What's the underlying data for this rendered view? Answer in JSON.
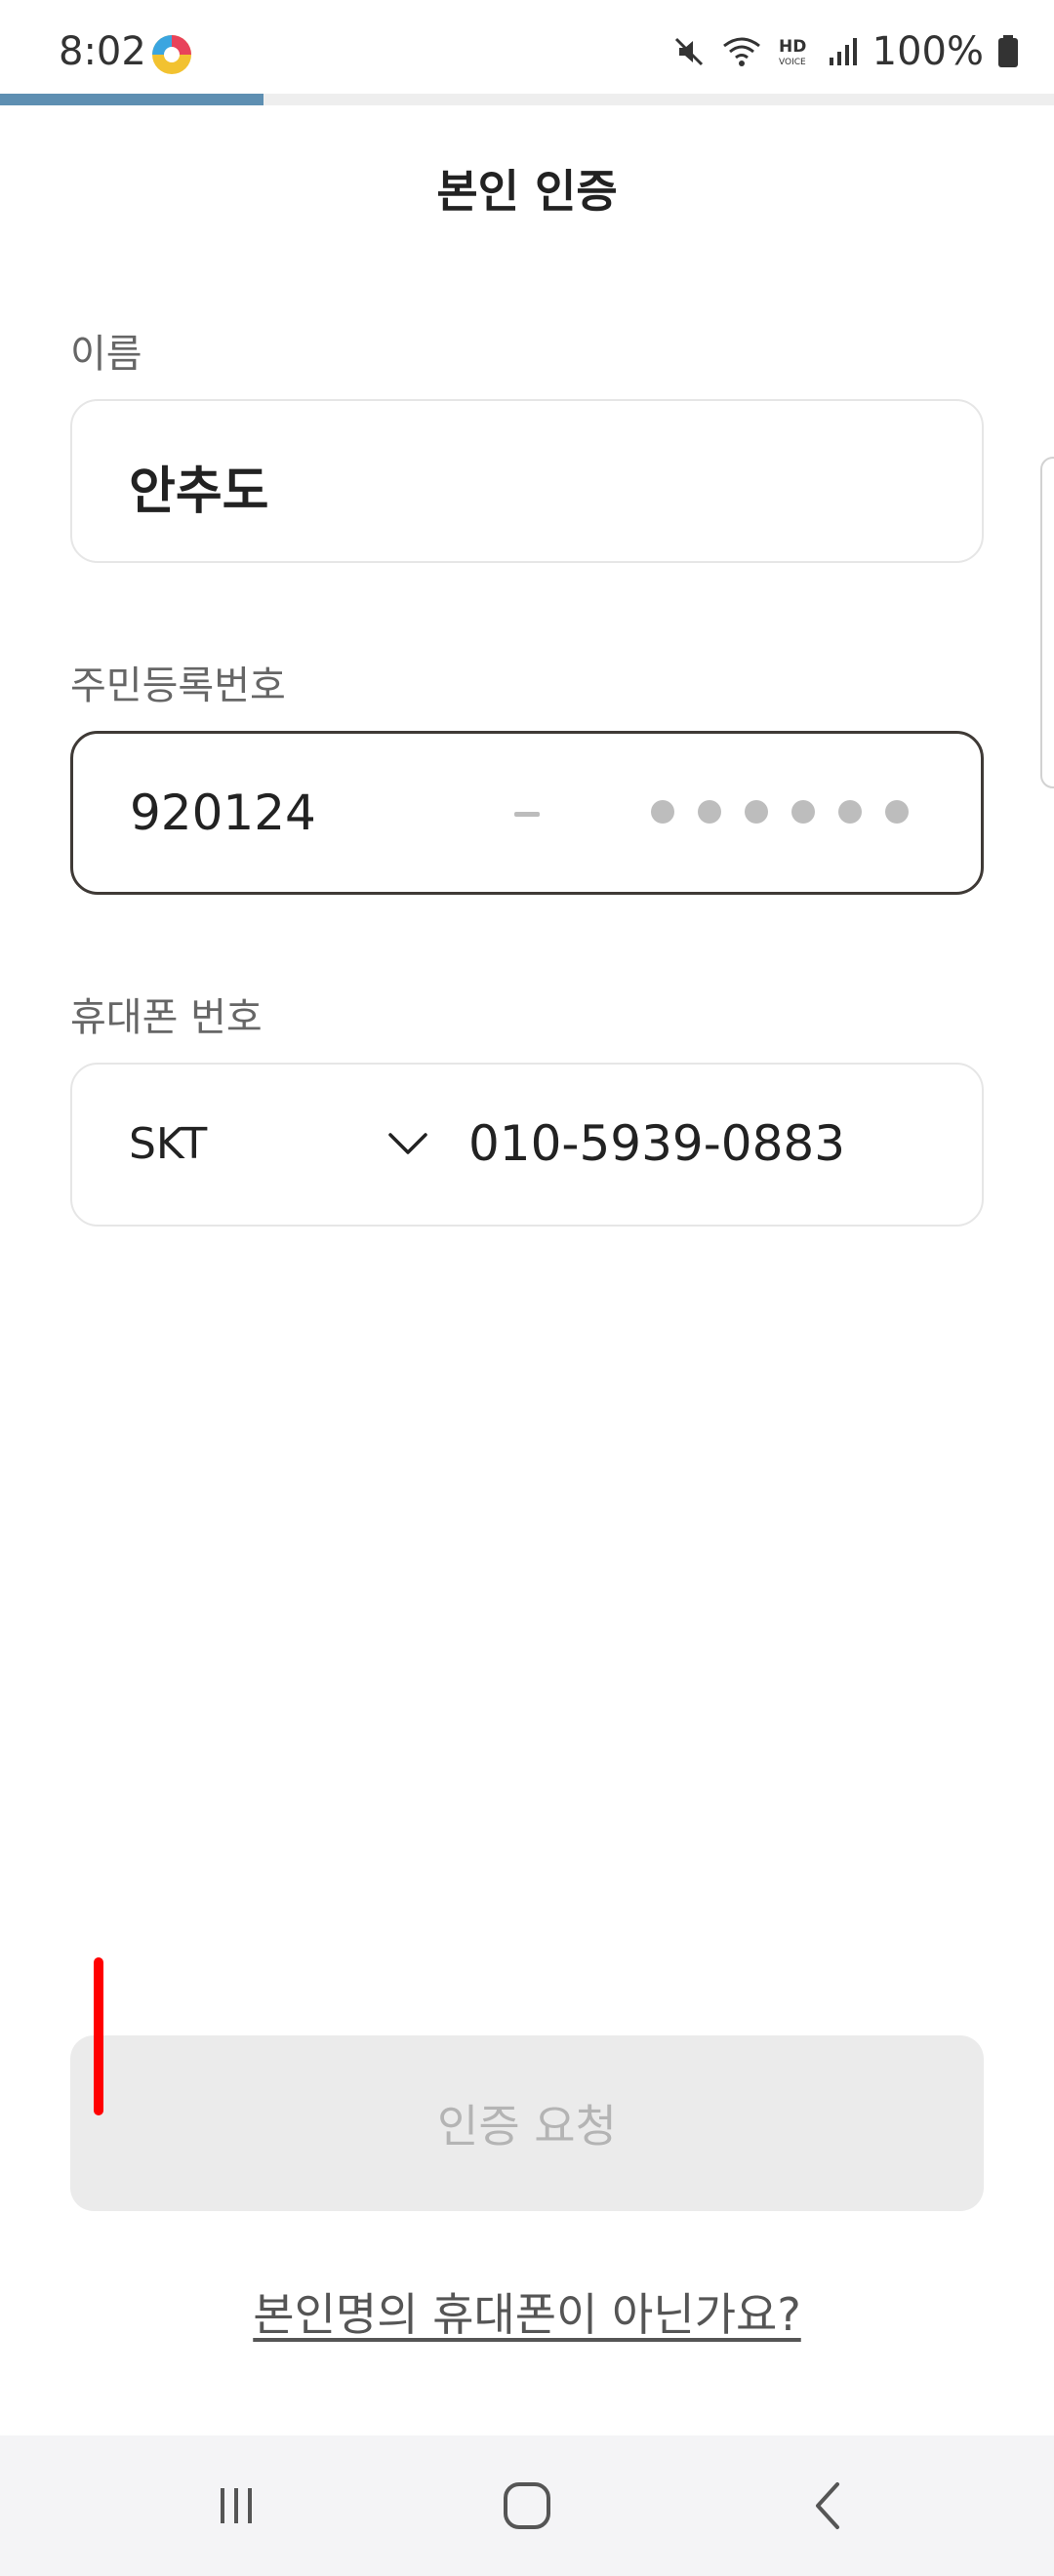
{
  "status_bar": {
    "time": "8:02",
    "battery_pct": "100%",
    "icons": [
      "mute-icon",
      "wifi-icon",
      "hd-voice-icon",
      "signal-icon",
      "battery-icon"
    ]
  },
  "progress": {
    "fraction": 0.25,
    "color": "#5e8fb2"
  },
  "header": {
    "title": "본인 인증"
  },
  "form": {
    "name": {
      "label": "이름",
      "value": "안추도"
    },
    "rrn": {
      "label": "주민등록번호",
      "front": "920124",
      "masked_digits": 6
    },
    "phone": {
      "label": "휴대폰 번호",
      "carrier": "SKT",
      "number": "010-5939-0883"
    }
  },
  "submit": {
    "label": "인증 요청",
    "enabled": false
  },
  "links": {
    "not_owner": "본인명의 휴대폰이 아닌가요?"
  },
  "nav": {
    "items": [
      "recent-apps",
      "home",
      "back"
    ]
  },
  "colors": {
    "focus_border": "#3f3a36",
    "accent": "#5e8fb2",
    "disabled_bg": "#ebebeb",
    "marker": "#ff0000"
  }
}
